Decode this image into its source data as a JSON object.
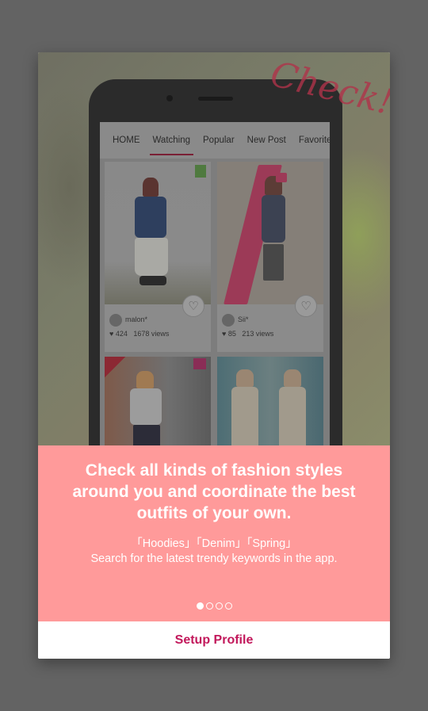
{
  "hero": {
    "script_text": "Check!",
    "tabs": [
      "HOME",
      "Watching",
      "Popular",
      "New Post",
      "Favorite"
    ],
    "active_tab": "Watching",
    "cards": [
      {
        "user": "malon*",
        "likes": "424",
        "views": "1678 views"
      },
      {
        "user": "Sii*",
        "likes": "85",
        "views": "213 views"
      }
    ]
  },
  "info": {
    "headline": "Check all kinds of fashion styles around you and coordinate the best outfits of your own.",
    "keywords": "「Hoodies」「Denim」「Spring」",
    "description": "Search for the latest trendy keywords in the app.",
    "page_indicator": {
      "current": 1,
      "total": 4
    }
  },
  "footer": {
    "setup_label": "Setup Profile"
  },
  "colors": {
    "accent": "#c2185b",
    "banner": "#ff9a9a",
    "overlay": "#636363"
  }
}
